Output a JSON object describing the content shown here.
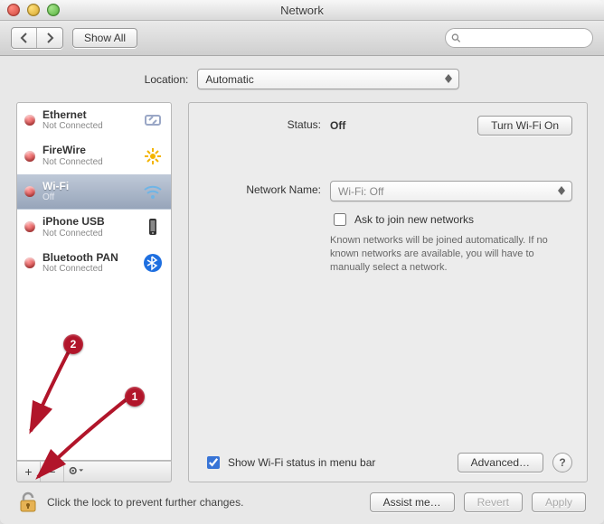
{
  "window": {
    "title": "Network"
  },
  "toolbar": {
    "back_label": "Back",
    "forward_label": "Forward",
    "show_all_label": "Show All",
    "search_placeholder": ""
  },
  "location": {
    "label": "Location:",
    "value": "Automatic"
  },
  "services": [
    {
      "name": "Ethernet",
      "status": "Not Connected",
      "selected": false,
      "color": "red",
      "icon": "ethernet"
    },
    {
      "name": "FireWire",
      "status": "Not Connected",
      "selected": false,
      "color": "red",
      "icon": "firewire"
    },
    {
      "name": "Wi-Fi",
      "status": "Off",
      "selected": true,
      "color": "red",
      "icon": "wifi"
    },
    {
      "name": "iPhone USB",
      "status": "Not Connected",
      "selected": false,
      "color": "red",
      "icon": "iphone"
    },
    {
      "name": "Bluetooth PAN",
      "status": "Not Connected",
      "selected": false,
      "color": "red",
      "icon": "bluetooth"
    }
  ],
  "list_toolbar": {
    "add": "+",
    "remove": "−",
    "action": "⚙︎"
  },
  "detail": {
    "status_label": "Status:",
    "status_value": "Off",
    "wifi_toggle_label": "Turn Wi-Fi On",
    "network_name_label": "Network Name:",
    "network_name_value": "Wi-Fi: Off",
    "ask_join_label": "Ask to join new networks",
    "ask_join_help": "Known networks will be joined automatically. If no known networks are available, you will have to manually select a network.",
    "show_menu_label": "Show Wi-Fi status in menu bar",
    "advanced_label": "Advanced…"
  },
  "footer": {
    "lock_text": "Click the lock to prevent further changes.",
    "assist_label": "Assist me…",
    "revert_label": "Revert",
    "apply_label": "Apply"
  },
  "annotations": {
    "badge1": "1",
    "badge2": "2"
  }
}
